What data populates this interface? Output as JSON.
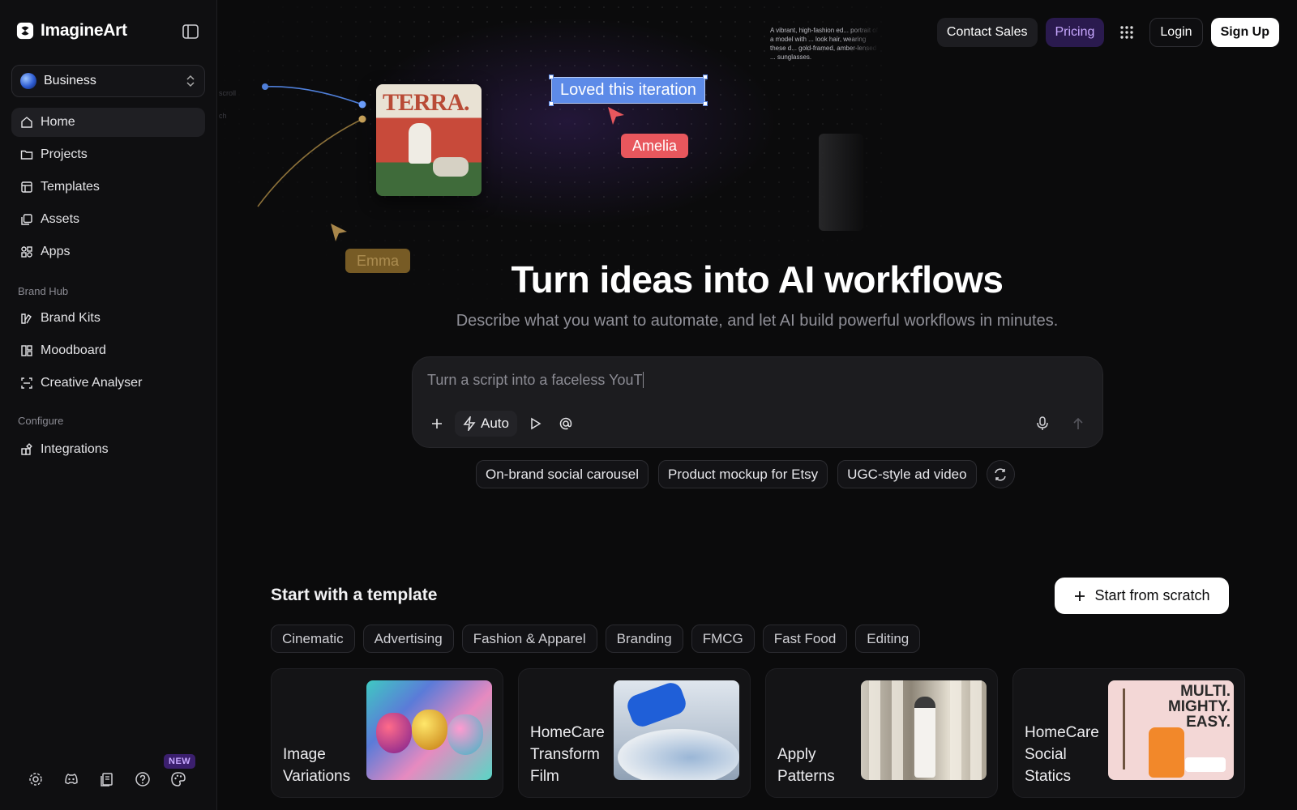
{
  "app": {
    "name": "ImagineArt"
  },
  "sidebar": {
    "workspace": "Business",
    "nav": [
      {
        "label": "Home",
        "icon": "home-icon"
      },
      {
        "label": "Projects",
        "icon": "folder-icon"
      },
      {
        "label": "Templates",
        "icon": "table-icon"
      },
      {
        "label": "Assets",
        "icon": "assets-icon"
      },
      {
        "label": "Apps",
        "icon": "apps-icon"
      }
    ],
    "brand_hub_label": "Brand Hub",
    "brand_hub": [
      {
        "label": "Brand Kits",
        "icon": "brand-kit-icon"
      },
      {
        "label": "Moodboard",
        "icon": "moodboard-icon"
      },
      {
        "label": "Creative Analyser",
        "icon": "scan-icon"
      }
    ],
    "configure_label": "Configure",
    "configure": [
      {
        "label": "Integrations",
        "icon": "integrations-icon"
      }
    ],
    "new_badge": "NEW"
  },
  "topbar": {
    "contact": "Contact Sales",
    "pricing": "Pricing",
    "login": "Login",
    "signup": "Sign Up"
  },
  "hero": {
    "iteration_text": "Loved this iteration",
    "collaborator1": "Amelia",
    "collaborator2": "Emma",
    "magazine_title": "TERRA.",
    "prompt_snippet": "A vibrant, high-fashion ed... portrait of a model with ... look hair, wearing these d... gold-framed, amber-lensed ... sunglasses.",
    "title": "Turn ideas into AI workflows",
    "subtitle": "Describe what you want to automate, and let AI build powerful workflows in minutes."
  },
  "prompt": {
    "text": "Turn a script into a faceless YouT",
    "mode": "Auto"
  },
  "suggestions": [
    "On-brand social carousel",
    "Product mockup for Etsy",
    "UGC-style ad video"
  ],
  "templates": {
    "title": "Start with a template",
    "scratch": "Start from scratch",
    "categories": [
      "Cinematic",
      "Advertising",
      "Fashion & Apparel",
      "Branding",
      "FMCG",
      "Fast Food",
      "Editing"
    ],
    "cards": [
      {
        "label": "Image Variations"
      },
      {
        "label": "HomeCare Transform Film"
      },
      {
        "label": "Apply Patterns"
      },
      {
        "label": "HomeCare Social Statics"
      }
    ],
    "card4_text": "MULTI. MIGHTY. EASY."
  },
  "colors": {
    "accent": "#c8a8ff",
    "selection": "#5d8be8",
    "amelia": "#e8575d",
    "emma": "#8a6a2a"
  }
}
